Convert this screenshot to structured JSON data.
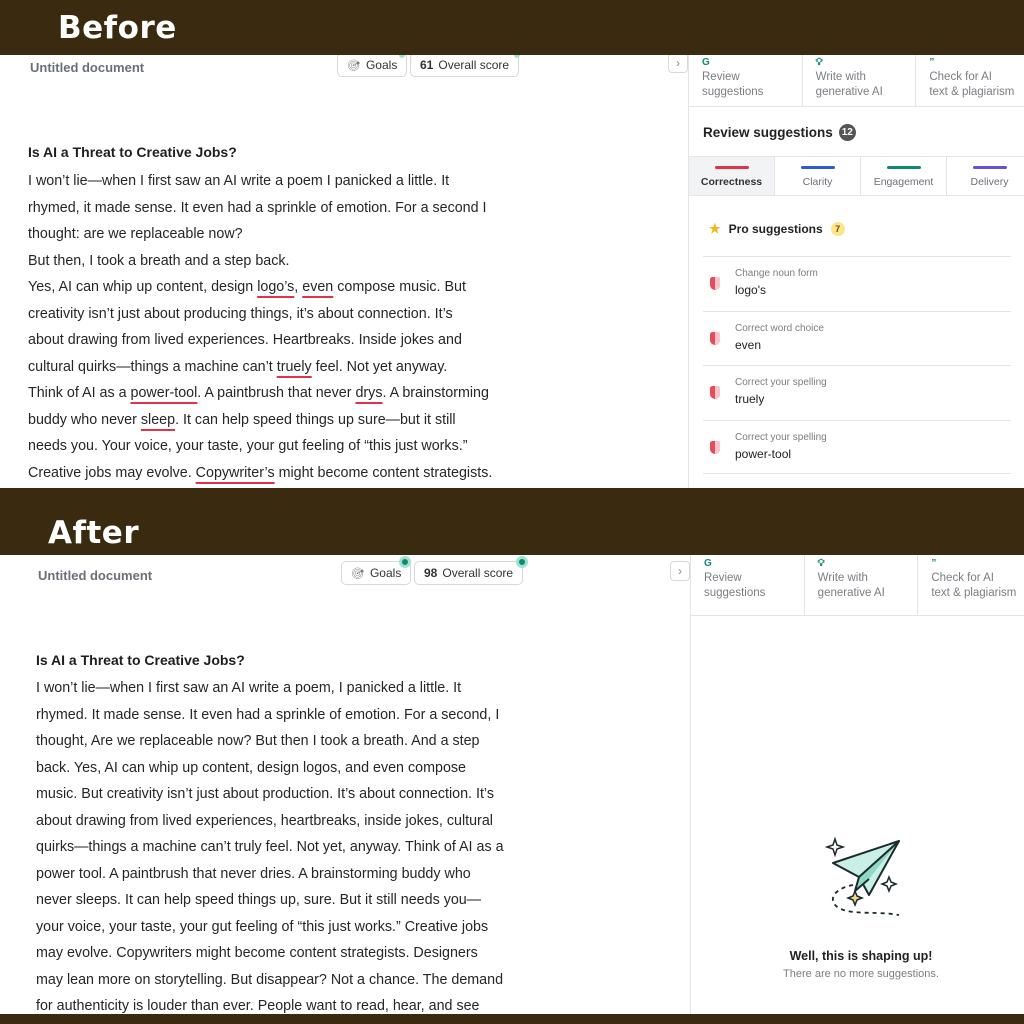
{
  "before": {
    "label": "Before",
    "doc_title": "Untitled document",
    "goals_label": "Goals",
    "score_value": "61",
    "score_label": "Overall score",
    "side_tabs": [
      {
        "line1": "Review",
        "line2": "suggestions",
        "icon": "grammarly-g-icon"
      },
      {
        "line1": "Write with",
        "line2": "generative AI",
        "icon": "lightbulb-icon"
      },
      {
        "line1": "Check for AI",
        "line2": "text & plagiarism",
        "icon": "quote-icon"
      }
    ],
    "review_title": "Review suggestions",
    "review_count": "12",
    "category_tabs": [
      {
        "label": "Correctness",
        "color": "#e0334a"
      },
      {
        "label": "Clarity",
        "color": "#2f5bd3"
      },
      {
        "label": "Engagement",
        "color": "#0f8a72"
      },
      {
        "label": "Delivery",
        "color": "#6a4fd6"
      }
    ],
    "pro_label": "Pro suggestions",
    "pro_count": "7",
    "suggestions": [
      {
        "category": "Change noun form",
        "word": "logo's"
      },
      {
        "category": "Correct word choice",
        "word": "even"
      },
      {
        "category": "Correct your spelling",
        "word": "truely"
      },
      {
        "category": "Correct your spelling",
        "word": "power-tool"
      }
    ],
    "heading": "Is AI a Threat to Creative Jobs?",
    "lines": [
      [
        "I won’t lie—when I first saw an AI write a poem I panicked a little. It"
      ],
      [
        "rhymed, it made sense. It even had a sprinkle of emotion. For a second I"
      ],
      [
        "thought: are we replaceable now?"
      ],
      [
        "But then, I took a breath and a step back."
      ],
      [
        "Yes, AI can whip up content, design ",
        {
          "err": "logo’s"
        },
        ", ",
        {
          "err": "even"
        },
        " compose music. But"
      ],
      [
        "creativity isn’t just about producing things, it’s about connection. It’s"
      ],
      [
        "about drawing from lived experiences. Heartbreaks. Inside jokes and"
      ],
      [
        "cultural quirks—things a machine can’t ",
        {
          "err": "truely"
        },
        " feel. Not yet anyway."
      ],
      [
        "Think of AI as a ",
        {
          "err": "power-tool"
        },
        ". A paintbrush that never ",
        {
          "err": "drys"
        },
        ". A brainstorming"
      ],
      [
        "buddy who never ",
        {
          "err": "sleep"
        },
        ". It can help speed things up sure—but it still"
      ],
      [
        "needs you. Your voice, your taste, your gut feeling of “this just works.”"
      ],
      [
        "Creative jobs may evolve. ",
        {
          "err": "Copywriter’s"
        },
        " might become content strategists."
      ]
    ]
  },
  "after": {
    "label": "After",
    "doc_title": "Untitled document",
    "goals_label": "Goals",
    "score_value": "98",
    "score_label": "Overall score",
    "side_tabs": [
      {
        "line1": "Review",
        "line2": "suggestions",
        "icon": "grammarly-g-icon"
      },
      {
        "line1": "Write with",
        "line2": "generative AI",
        "icon": "lightbulb-icon"
      },
      {
        "line1": "Check for AI",
        "line2": "text & plagiarism",
        "icon": "quote-icon"
      }
    ],
    "heading": "Is AI a Threat to Creative Jobs?",
    "lines": [
      "I won’t lie—when I first saw an AI write a poem, I panicked a little. It",
      "rhymed. It made sense. It even had a sprinkle of emotion. For a second, I",
      "thought, Are we replaceable now? But then I took a breath. And a step",
      "back. Yes, AI can whip up content, design logos, and even compose",
      "music. But creativity isn’t just about production. It’s about connection. It’s",
      "about drawing from lived experiences, heartbreaks, inside jokes, cultural",
      "quirks—things a machine can’t truly feel. Not yet, anyway. Think of AI as a",
      "power tool. A paintbrush that never dries. A brainstorming buddy who",
      "never sleeps. It can help speed things up, sure. But it still needs you—",
      "your voice, your taste, your gut feeling of “this just works.” Creative jobs",
      "may evolve. Copywriters might become content strategists. Designers",
      "may lean more on storytelling. But disappear? Not a chance. The demand",
      "for authenticity is louder than ever. People want to read, hear, and see"
    ],
    "done_title": "Well, this is shaping up!",
    "done_subtitle": "There are no more suggestions."
  }
}
